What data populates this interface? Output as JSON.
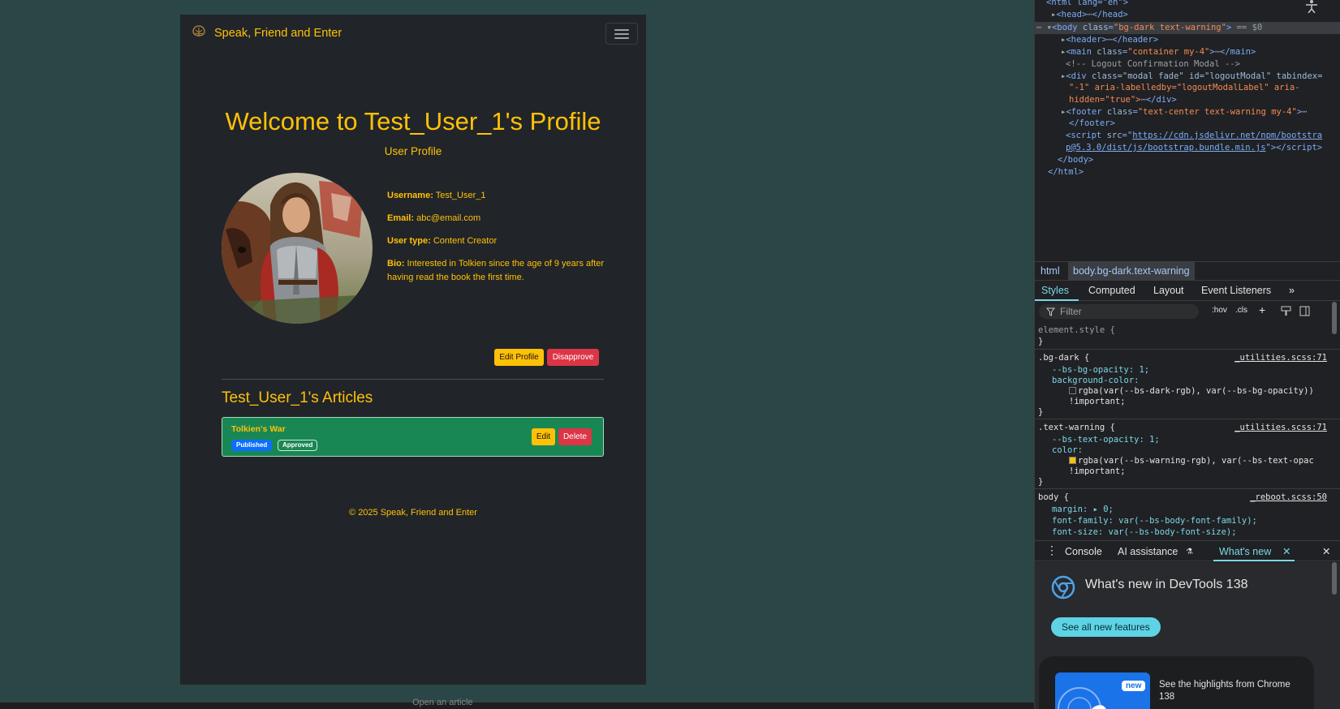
{
  "site": {
    "brand": "Speak, Friend and Enter",
    "title": "Welcome to Test_User_1's Profile",
    "subtitle": "User Profile",
    "profile": {
      "username_label": "Username:",
      "username": "Test_User_1",
      "email_label": "Email:",
      "email": "abc@email.com",
      "usertype_label": "User type:",
      "usertype": "Content Creator",
      "bio_label": "Bio:",
      "bio": "Interested in Tolkien since the age of 9 years after having read the book the first time."
    },
    "buttons": {
      "edit_profile": "Edit Profile",
      "disapprove": "Disapprove"
    },
    "articles_heading": "Test_User_1's Articles",
    "articles": [
      {
        "title": "Tolkien's War",
        "badges": [
          "Published",
          "Approved"
        ],
        "edit": "Edit",
        "delete": "Delete"
      }
    ],
    "footer": "© 2025 Speak, Friend and Enter"
  },
  "devtools": {
    "dom": {
      "html_open": "<html lang=\"en\">",
      "head": "head",
      "body_class": "bg-dark text-warning",
      "body_suffix": " == $0",
      "header": "header",
      "main_class": "container my-4",
      "comment": "<!-- Logout Confirmation Modal -->",
      "modal_line1": "class=\"modal fade\" id=\"logoutModal\" tabindex=",
      "modal_line2": "\"-1\" aria-labelledby=\"logoutModalLabel\" aria-",
      "modal_line3": "hidden=\"true\">",
      "footer_class": "text-center text-warning my-4",
      "script_src1": "https://cdn.jsdelivr.net/npm/bootstra",
      "script_src2": "p@5.3.0/dist/js/bootstrap.bundle.min.js",
      "body_close": "</body>",
      "html_close": "</html>"
    },
    "breadcrumbs": [
      "html",
      "body.bg-dark.text-warning"
    ],
    "tabs": [
      "Styles",
      "Computed",
      "Layout",
      "Event Listeners"
    ],
    "filter_placeholder": "Filter",
    "filter_tools": [
      ":hov",
      ".cls"
    ],
    "styles": {
      "element_style": "element.style {",
      "rule1_selector": ".bg-dark {",
      "rule1_file": "_utilities.scss:71",
      "rule1_p1": "--bs-bg-opacity: 1;",
      "rule1_p2": "background-color:",
      "rule1_p2v": "rgba(var(--bs-dark-rgb), var(--bs-bg-opacity))",
      "rule2_selector": ".text-warning {",
      "rule2_file": "_utilities.scss:71",
      "rule2_p1": "--bs-text-opacity: 1;",
      "rule2_p2": "color:",
      "rule2_p2v": "rgba(var(--bs-warning-rgb), var(--bs-text-opac",
      "important": "!important;",
      "rule3_selector": "body {",
      "rule3_file": "_reboot.scss:50",
      "rule3_p1": "margin: ▸ 0;",
      "rule3_p2": "font-family: var(--bs-body-font-family);",
      "rule3_p3": "font-size: var(--bs-body-font-size);"
    },
    "drawer_tabs": [
      "Console",
      "AI assistance",
      "What's new"
    ],
    "whats_new": {
      "title": "What's new in DevTools 138",
      "button": "See all new features",
      "badge": "new",
      "card_text": "See the highlights from Chrome 138"
    }
  },
  "taskbar_text": "Open an article",
  "colors": {
    "warning": "#ffc107",
    "danger": "#dc3545",
    "success": "#198754",
    "primary": "#0d6efd",
    "dark": "#212529"
  }
}
